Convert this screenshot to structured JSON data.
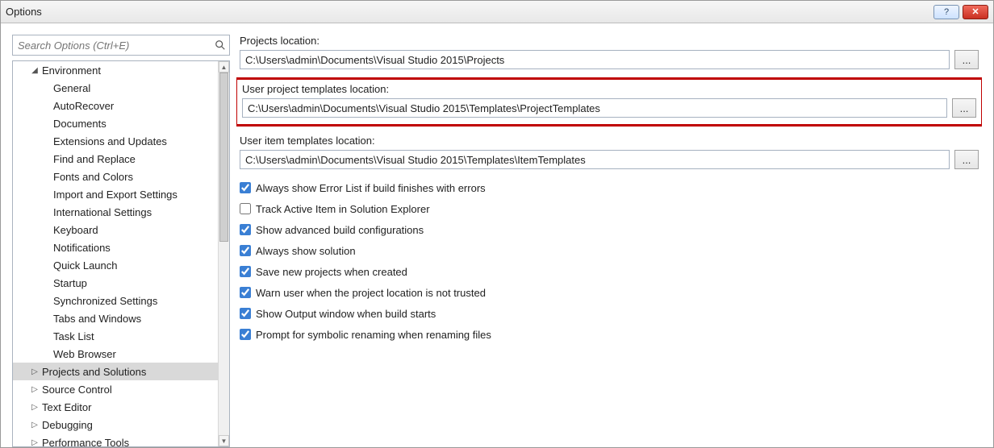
{
  "window": {
    "title": "Options"
  },
  "sidebar": {
    "search_placeholder": "Search Options (Ctrl+E)",
    "env": {
      "label": "Environment",
      "children": [
        "General",
        "AutoRecover",
        "Documents",
        "Extensions and Updates",
        "Find and Replace",
        "Fonts and Colors",
        "Import and Export Settings",
        "International Settings",
        "Keyboard",
        "Notifications",
        "Quick Launch",
        "Startup",
        "Synchronized Settings",
        "Tabs and Windows",
        "Task List",
        "Web Browser"
      ]
    },
    "top": [
      "Projects and Solutions",
      "Source Control",
      "Text Editor",
      "Debugging",
      "Performance Tools"
    ],
    "selected": "Projects and Solutions"
  },
  "fields": {
    "projects_location": {
      "label": "Projects location:",
      "value": "C:\\Users\\admin\\Documents\\Visual Studio 2015\\Projects"
    },
    "user_project_templates": {
      "label": "User project templates location:",
      "value": "C:\\Users\\admin\\Documents\\Visual Studio 2015\\Templates\\ProjectTemplates"
    },
    "user_item_templates": {
      "label": "User item templates location:",
      "value": "C:\\Users\\admin\\Documents\\Visual Studio 2015\\Templates\\ItemTemplates"
    }
  },
  "checkboxes": [
    {
      "label": "Always show Error List if build finishes with errors",
      "checked": true
    },
    {
      "label": "Track Active Item in Solution Explorer",
      "checked": false
    },
    {
      "label": "Show advanced build configurations",
      "checked": true
    },
    {
      "label": "Always show solution",
      "checked": true
    },
    {
      "label": "Save new projects when created",
      "checked": true
    },
    {
      "label": "Warn user when the project location is not trusted",
      "checked": true
    },
    {
      "label": "Show Output window when build starts",
      "checked": true
    },
    {
      "label": "Prompt for symbolic renaming when renaming files",
      "checked": true
    }
  ],
  "browse_label": "..."
}
